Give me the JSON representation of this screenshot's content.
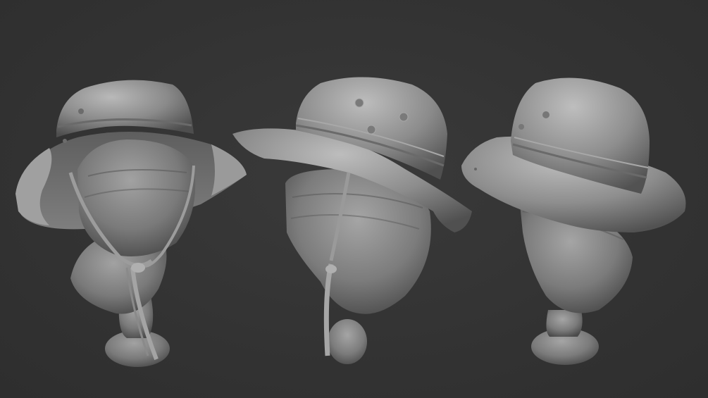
{
  "scene": {
    "background_color": "#323232",
    "material_color": "#8a8a8a",
    "views": [
      {
        "label": "",
        "subject": "bucket-hat-on-head-front-view"
      },
      {
        "label": "",
        "subject": "bucket-hat-on-head-side-view"
      },
      {
        "label": "",
        "subject": "bucket-hat-on-head-back-view"
      }
    ]
  }
}
